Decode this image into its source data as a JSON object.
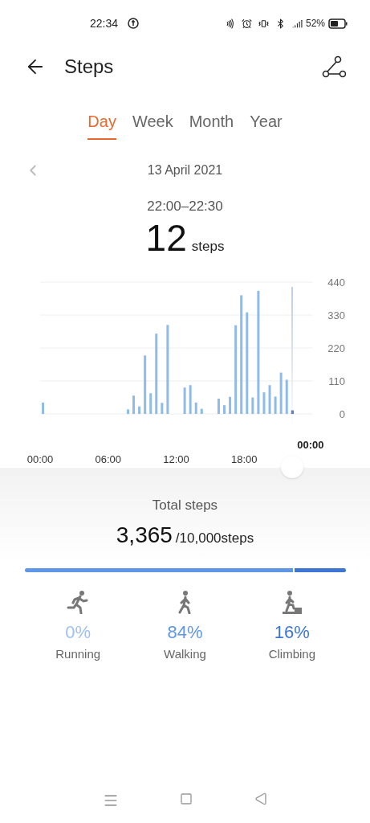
{
  "status_bar": {
    "time": "22:34",
    "battery": "52%"
  },
  "header": {
    "title": "Steps"
  },
  "tabs": [
    {
      "label": "Day",
      "selected": true
    },
    {
      "label": "Week",
      "selected": false
    },
    {
      "label": "Month",
      "selected": false
    },
    {
      "label": "Year",
      "selected": false
    }
  ],
  "date": "13 April 2021",
  "selection": {
    "range": "22:00–22:30",
    "value": "12",
    "unit": "steps",
    "cursor_label": "00:00"
  },
  "chart_data": {
    "type": "bar",
    "x": [
      0.25,
      7.75,
      8.25,
      8.75,
      9.25,
      9.75,
      10.25,
      10.75,
      11.25,
      12.75,
      13.25,
      13.75,
      14.25,
      15.75,
      16.25,
      16.75,
      17.25,
      17.75,
      18.25,
      18.75,
      19.25,
      19.75,
      20.25,
      20.75,
      21.25,
      21.75,
      22.25
    ],
    "values": [
      38,
      15,
      61,
      25,
      195,
      69,
      268,
      37,
      297,
      88,
      96,
      38,
      17,
      51,
      29,
      57,
      296,
      396,
      339,
      55,
      411,
      72,
      96,
      58,
      138,
      114,
      12
    ],
    "xlim": [
      0,
      24
    ],
    "ylim": [
      0,
      440
    ],
    "grid": true,
    "xticks": [
      {
        "value": 0,
        "label": "00:00"
      },
      {
        "value": 6,
        "label": "06:00"
      },
      {
        "value": 12,
        "label": "12:00"
      },
      {
        "value": 18,
        "label": "18:00"
      }
    ],
    "yticks": [
      0,
      110,
      220,
      330,
      440
    ]
  },
  "total": {
    "label": "Total steps",
    "value": "3,365",
    "goal": "/10,000steps"
  },
  "activities": [
    {
      "kind": "running",
      "percent": "0%",
      "label": "Running",
      "color": "#9fc1f0"
    },
    {
      "kind": "walking",
      "percent": "84%",
      "label": "Walking",
      "color": "#6096e6"
    },
    {
      "kind": "climbing",
      "percent": "16%",
      "label": "Climbing",
      "color": "#3d76d4"
    }
  ]
}
